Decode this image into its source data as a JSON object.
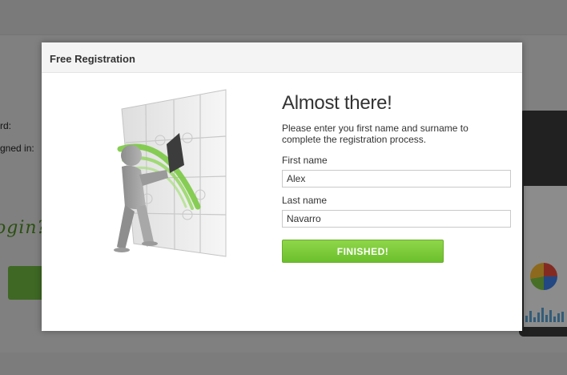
{
  "background": {
    "label_password": "rd:",
    "label_signed": "gned in:",
    "script_text": "ogin?"
  },
  "modal": {
    "title": "Free Registration",
    "heading": "Almost there!",
    "description": "Please enter you first name and surname to complete the registration process.",
    "first_name_label": "First name",
    "first_name_value": "Alex",
    "last_name_label": "Last name",
    "last_name_value": "Navarro",
    "finish_label": "FINISHED!"
  },
  "colors": {
    "accent_green": "#7ac943",
    "overlay": "#000000"
  },
  "icons": {
    "illustration": "puzzle-figure-illustration"
  }
}
